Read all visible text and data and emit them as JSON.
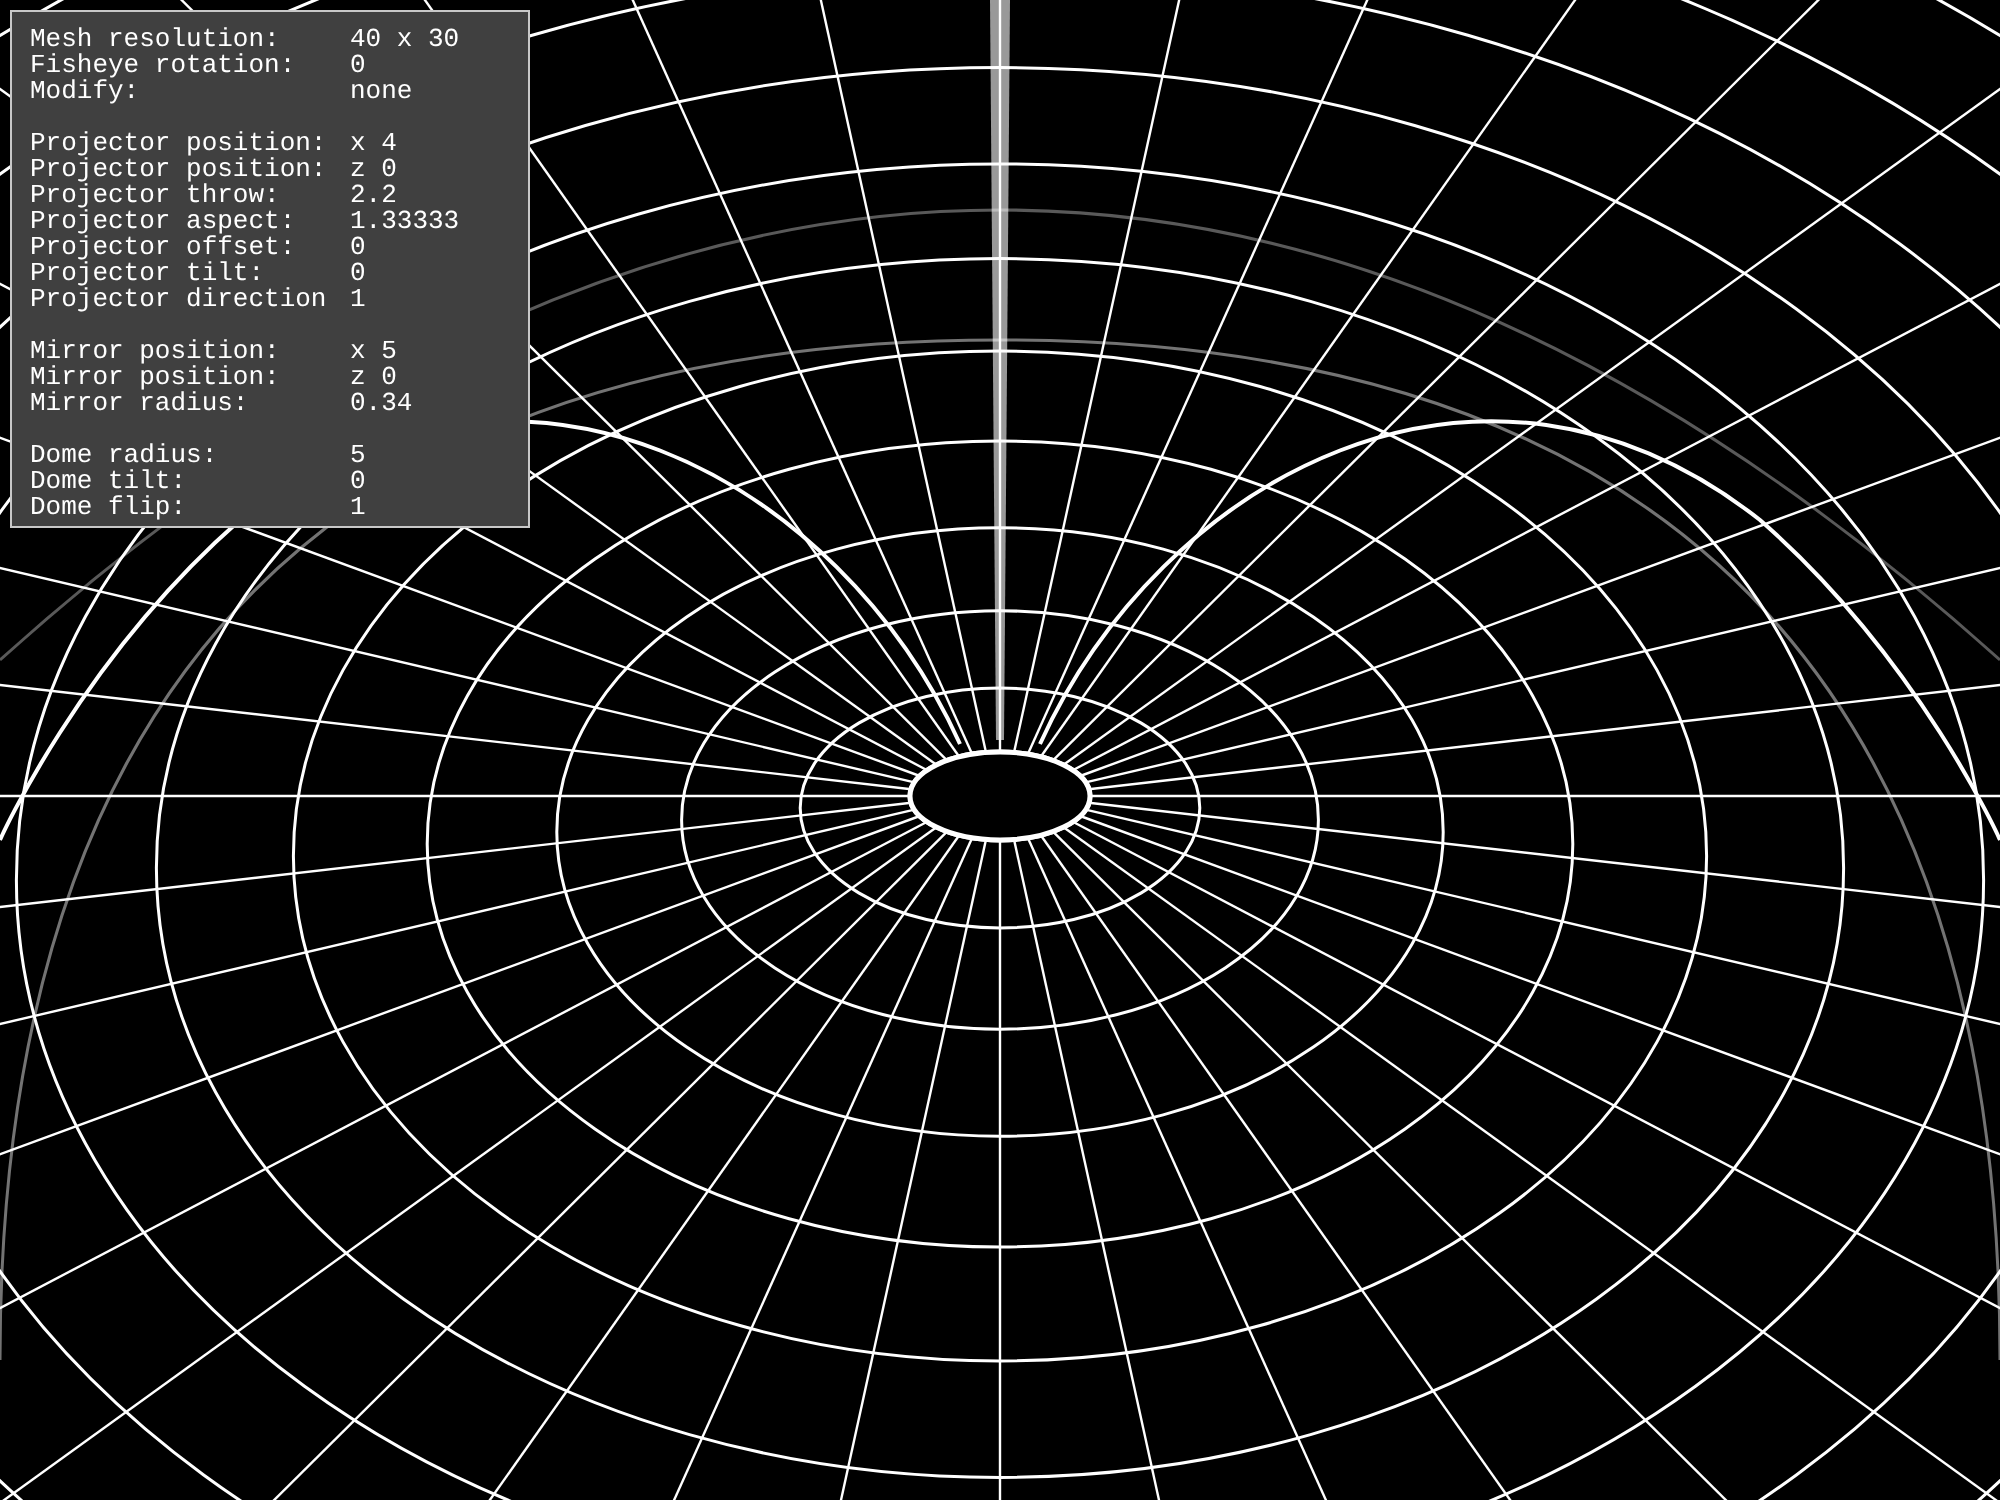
{
  "info_panel": {
    "groups": [
      {
        "rows": [
          {
            "label": "Mesh resolution:",
            "value": "40 x 30"
          },
          {
            "label": "Fisheye rotation:",
            "value": "0"
          },
          {
            "label": "Modify:",
            "value": "none"
          }
        ]
      },
      {
        "rows": [
          {
            "label": "Projector position:",
            "value": "x 4"
          },
          {
            "label": "Projector position:",
            "value": "z 0"
          },
          {
            "label": "Projector throw:",
            "value": "2.2"
          },
          {
            "label": "Projector aspect:",
            "value": "1.33333"
          },
          {
            "label": "Projector offset:",
            "value": "0"
          },
          {
            "label": "Projector tilt:",
            "value": "0"
          },
          {
            "label": "Projector direction",
            "value": "1"
          }
        ]
      },
      {
        "rows": [
          {
            "label": "Mirror position:",
            "value": "x 5"
          },
          {
            "label": "Mirror position:",
            "value": "z 0"
          },
          {
            "label": "Mirror radius:",
            "value": "0.34"
          }
        ]
      },
      {
        "rows": [
          {
            "label": "Dome radius:",
            "value": "5"
          },
          {
            "label": "Dome tilt:",
            "value": "0"
          },
          {
            "label": "Dome flip:",
            "value": "1"
          }
        ]
      }
    ]
  }
}
